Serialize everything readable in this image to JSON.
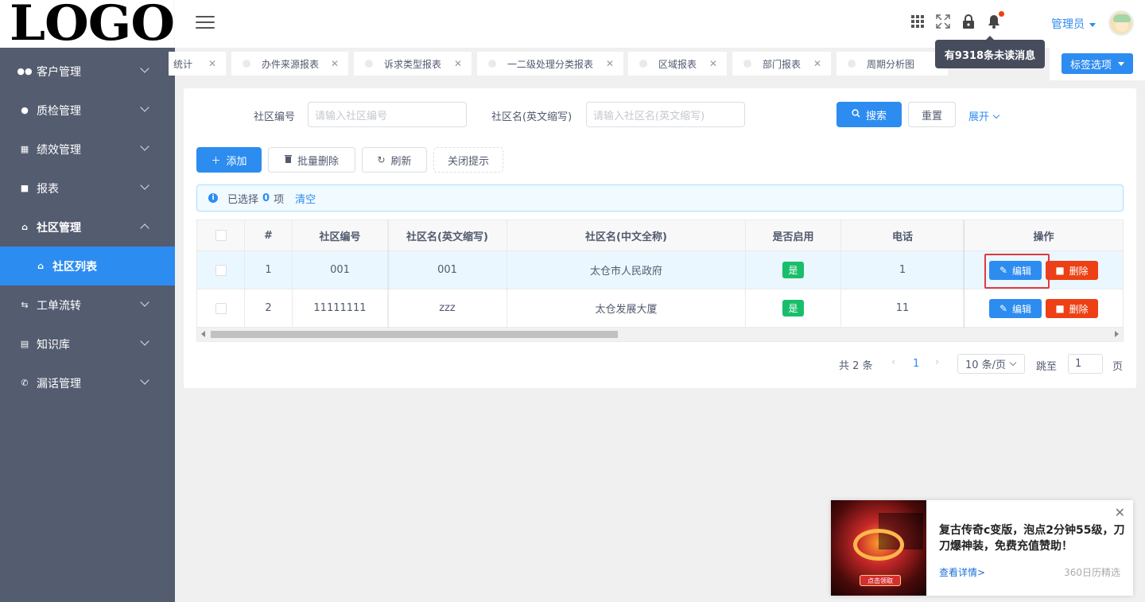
{
  "logo": "LOGO",
  "sidebar": {
    "items": [
      {
        "label": "客户管理",
        "icon": "users-icon"
      },
      {
        "label": "质检管理",
        "icon": "alert-circle-icon"
      },
      {
        "label": "绩效管理",
        "icon": "chart-icon"
      },
      {
        "label": "报表",
        "icon": "briefcase-icon"
      },
      {
        "label": "社区管理",
        "icon": "home-icon"
      },
      {
        "label": "社区列表",
        "icon": "home-icon"
      },
      {
        "label": "工单流转",
        "icon": "refresh-icon"
      },
      {
        "label": "知识库",
        "icon": "book-icon"
      },
      {
        "label": "漏话管理",
        "icon": "phone-icon"
      }
    ]
  },
  "header": {
    "user": "管理员",
    "tooltip": "有9318条未读消息"
  },
  "tabs": {
    "items": [
      {
        "label": "统计"
      },
      {
        "label": "办件来源报表"
      },
      {
        "label": "诉求类型报表"
      },
      {
        "label": "一二级处理分类报表"
      },
      {
        "label": "区域报表"
      },
      {
        "label": "部门报表"
      },
      {
        "label": "周期分析图"
      }
    ],
    "options_label": "标签选项"
  },
  "search": {
    "code_label": "社区编号",
    "code_placeholder": "请输入社区编号",
    "name_label": "社区名(英文缩写)",
    "name_placeholder": "请输入社区名(英文缩写)",
    "search_btn": "搜索",
    "reset_btn": "重置",
    "expand": "展开"
  },
  "toolbar": {
    "add": "添加",
    "batch_delete": "批量删除",
    "refresh": "刷新",
    "close_tip": "关闭提示"
  },
  "alert": {
    "prefix": "已选择",
    "count": "0",
    "suffix": "项",
    "clear": "清空"
  },
  "table": {
    "columns": [
      "#",
      "社区编号",
      "社区名(英文缩写)",
      "社区名(中文全称)",
      "是否启用",
      "电话",
      "操作"
    ],
    "rows": [
      {
        "index": "1",
        "code": "001",
        "abbr": "001",
        "full": "太仓市人民政府",
        "enabled": "是",
        "phone": "1"
      },
      {
        "index": "2",
        "code": "11111111",
        "abbr": "zzz",
        "full": "太仓发展大厦",
        "enabled": "是",
        "phone": "11"
      }
    ],
    "edit": "编辑",
    "delete": "删除"
  },
  "pagination": {
    "total": "共 2 条",
    "current": "1",
    "page_size": "10 条/页",
    "jump": "跳至",
    "jump_value": "1",
    "page": "页"
  },
  "ad": {
    "title": "复古传奇c变版，泡点2分钟55级，刀刀爆神装，免费充值赞助！",
    "more": "查看详情>",
    "source": "360日历精选",
    "image_button": "点击领取"
  },
  "colors": {
    "primary": "#2d8cf0",
    "sidebar": "#545c70",
    "success": "#19be6b",
    "danger": "#ed4014"
  }
}
